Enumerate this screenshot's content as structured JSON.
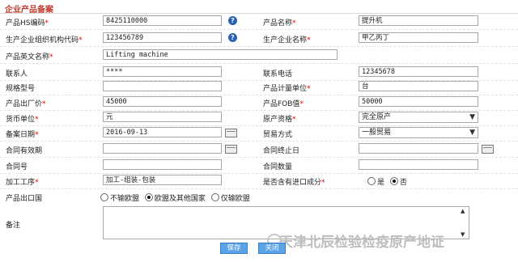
{
  "form": {
    "title": "企业产品备案",
    "required_mark": "*",
    "labels": {
      "hs_code": "产品HS编码",
      "product_name": "产品名称",
      "org_code": "生产企业组织机构代码",
      "company_name": "生产企业名称",
      "english_name": "产品英文名称",
      "contact": "联系人",
      "phone": "联系电话",
      "spec": "规格型号",
      "unit": "产品计量单位",
      "factory_price": "产品出厂价",
      "fob": "产品FOB值",
      "currency": "货币单位",
      "origin_qual": "原产资格",
      "record_date": "备案日期",
      "trade_mode": "贸易方式",
      "contract_start": "合同有效期",
      "contract_end": "合同终止日",
      "contract_no": "合同号",
      "contract_qty": "合同数量",
      "process": "加工工序",
      "import_content": "是否含有进口成分",
      "export_country": "产品出口国",
      "notes": "备注"
    },
    "values": {
      "hs_code": "8425110000",
      "product_name": "提升机",
      "org_code": "123456789",
      "company_name": "甲乙丙丁",
      "english_name": "Lifting machine",
      "contact": "****",
      "phone": "12345678",
      "spec": "",
      "unit": "台",
      "factory_price": "45000",
      "fob": "50000",
      "currency": "元",
      "origin_qual": "完全原产",
      "record_date": "2016-09-13",
      "trade_mode": "一般贸易",
      "contract_start": "",
      "contract_end": "",
      "contract_no": "",
      "contract_qty": "",
      "process": "加工-组装-包装",
      "notes": ""
    },
    "import_content_options": [
      {
        "label": "是",
        "selected": false
      },
      {
        "label": "否",
        "selected": true
      }
    ],
    "export_country_options": [
      {
        "label": "不输欧盟",
        "selected": false
      },
      {
        "label": "欧盟及其他国家",
        "selected": true
      },
      {
        "label": "仅输欧盟",
        "selected": false
      }
    ],
    "icons": {
      "help": "help-icon",
      "calendar": "calendar-icon",
      "dropdown": "chevron-down-icon"
    }
  },
  "buttons": {
    "save": "保存",
    "close": "关闭"
  },
  "watermark": {
    "text": "天津北辰检验检疫原产地证"
  },
  "colors": {
    "title": "#c0392b",
    "required": "#e60000",
    "help_icon": "#2a62b3",
    "button": "#5aa3e6"
  }
}
